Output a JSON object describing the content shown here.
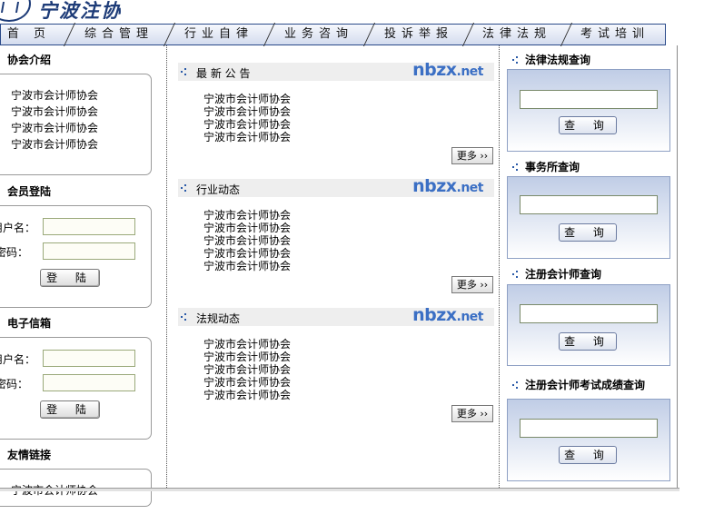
{
  "header": {
    "logo_text": "宁波注协"
  },
  "nav": {
    "items": [
      "首 页",
      "综合管理",
      "行业自律",
      "业务咨询",
      "投诉举报",
      "法律法规",
      "考试培训"
    ]
  },
  "left": {
    "about": {
      "title": "协会介绍",
      "lines": [
        "宁波市会计师协会",
        "宁波市会计师协会",
        "宁波市会计师协会",
        "宁波市会计师协会"
      ]
    },
    "login": {
      "title": "会员登陆",
      "username_label": "用户名：",
      "password_label": "密码：",
      "button": "登 陆"
    },
    "mail": {
      "title": "电子信箱",
      "username_label": "用户名：",
      "password_label": "密码：",
      "button": "登 陆"
    },
    "links": {
      "title": "友情链接",
      "partial_line": "宁波市会计师协会"
    }
  },
  "middle": {
    "watermark_main": "nbzx",
    "watermark_suffix": ".net",
    "more_label": "更多",
    "sections": [
      {
        "title": "最 新 公 告",
        "lines": [
          "宁波市会计师协会",
          "宁波市会计师协会",
          "宁波市会计师协会",
          "宁波市会计师协会"
        ]
      },
      {
        "title": "行业动态",
        "lines": [
          "宁波市会计师协会",
          "宁波市会计师协会",
          "宁波市会计师协会",
          "宁波市会计师协会",
          "宁波市会计师协会"
        ]
      },
      {
        "title": "法规动态",
        "lines": [
          "宁波市会计师协会",
          "宁波市会计师协会",
          "宁波市会计师协会",
          "宁波市会计师协会",
          "宁波市会计师协会"
        ]
      }
    ]
  },
  "right": {
    "button": "查 询",
    "sections": [
      {
        "title": "法律法规查询"
      },
      {
        "title": "事务所查询"
      },
      {
        "title": "注册会计师查询"
      },
      {
        "title": "注册会计师考试成绩查询"
      }
    ]
  },
  "colors": {
    "nav_border": "#2a4a8a",
    "watermark": "#3b6fc4",
    "panel_top": "#c0cde6"
  }
}
